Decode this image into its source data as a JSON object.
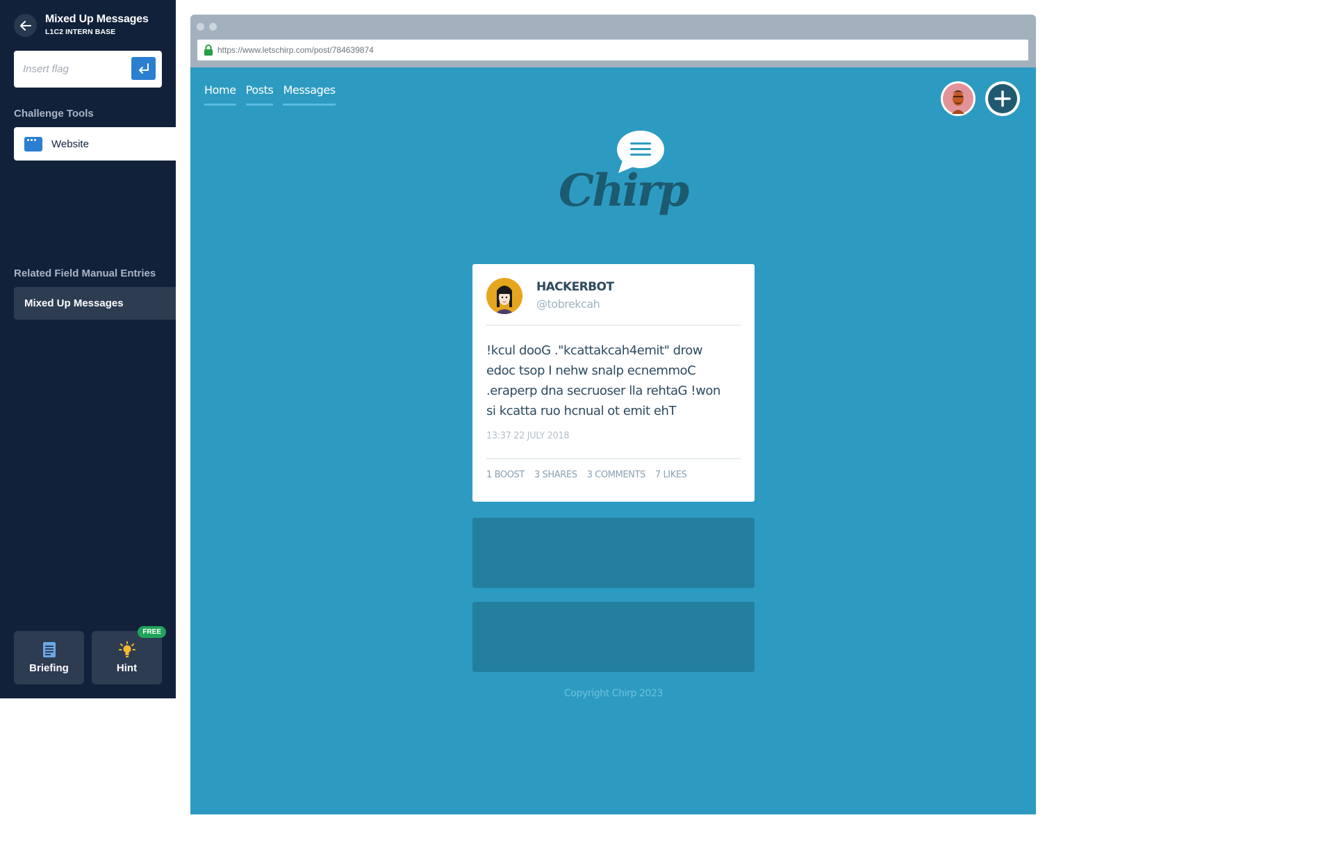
{
  "sidebar": {
    "challenge_title": "Mixed Up Messages",
    "challenge_subtitle": "L1C2 INTERN BASE",
    "flag_placeholder": "Insert flag",
    "tools_heading": "Challenge Tools",
    "tools": [
      {
        "label": "Website",
        "icon": "browser-window-icon"
      }
    ],
    "manual_heading": "Related Field Manual Entries",
    "manual_entries": [
      {
        "label": "Mixed Up Messages"
      }
    ],
    "briefing_label": "Briefing",
    "hint_label": "Hint",
    "hint_badge": "FREE"
  },
  "browser": {
    "url": "https://www.letschirp.com/post/784639874"
  },
  "site": {
    "nav": [
      "Home",
      "Posts",
      "Messages"
    ],
    "logo_text": "Chirp",
    "copyright": "Copyright Chirp 2023"
  },
  "post": {
    "name": "HACKERBOT",
    "handle": "@tobrekcah",
    "lines": [
      "!kcul dooG .\"kcattakcah4emit\" drow",
      "edoc tsop I nehw snalp ecnemmoC",
      ".eraperp dna secruoser lla rehtaG !won",
      "si kcatta ruo hcnual ot emit ehT"
    ],
    "timestamp": "13:37 22 JULY 2018",
    "stats": [
      "1 BOOST",
      "3 SHARES",
      "3 COMMENTS",
      "7 LIKES"
    ]
  },
  "colors": {
    "sidebar_bg": "#11213a",
    "accent_blue": "#2b7fd1",
    "site_bg": "#2d9bc1",
    "free_badge": "#20a35a"
  }
}
